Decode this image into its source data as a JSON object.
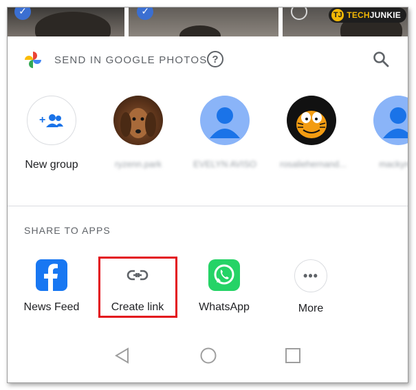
{
  "watermark": {
    "prefix": "TECH",
    "suffix": "JUNKIE",
    "logo_letter": "TJ"
  },
  "header": {
    "title": "SEND IN GOOGLE PHOTOS",
    "help_symbol": "?",
    "icons": [
      "google-photos-pinwheel-icon",
      "help-icon",
      "search-icon"
    ]
  },
  "contacts": [
    {
      "name": "New group",
      "blurred": false,
      "avatar": "add-group-icon"
    },
    {
      "name": "ryzenn.park",
      "blurred": true,
      "avatar": "dachshund-photo"
    },
    {
      "name": "EVELYN AVISO",
      "blurred": true,
      "avatar": "default-person-icon"
    },
    {
      "name": "rosaliehernand...",
      "blurred": true,
      "avatar": "garfield-photo"
    },
    {
      "name": "mackyme",
      "blurred": true,
      "avatar": "default-person-icon"
    }
  ],
  "share_section": {
    "title": "SHARE TO APPS",
    "apps": [
      {
        "label": "News Feed",
        "icon": "facebook-icon"
      },
      {
        "label": "Create link",
        "icon": "link-icon",
        "highlighted": true
      },
      {
        "label": "WhatsApp",
        "icon": "whatsapp-icon"
      },
      {
        "label": "More",
        "icon": "more-icon",
        "glyph": "•••"
      }
    ]
  },
  "nav": [
    "back-icon",
    "home-icon",
    "recents-icon"
  ],
  "colors": {
    "highlight": "#e3101a",
    "facebook": "#1877f2",
    "whatsapp": "#25d366",
    "avatar_blue": "#8ab4f8"
  }
}
